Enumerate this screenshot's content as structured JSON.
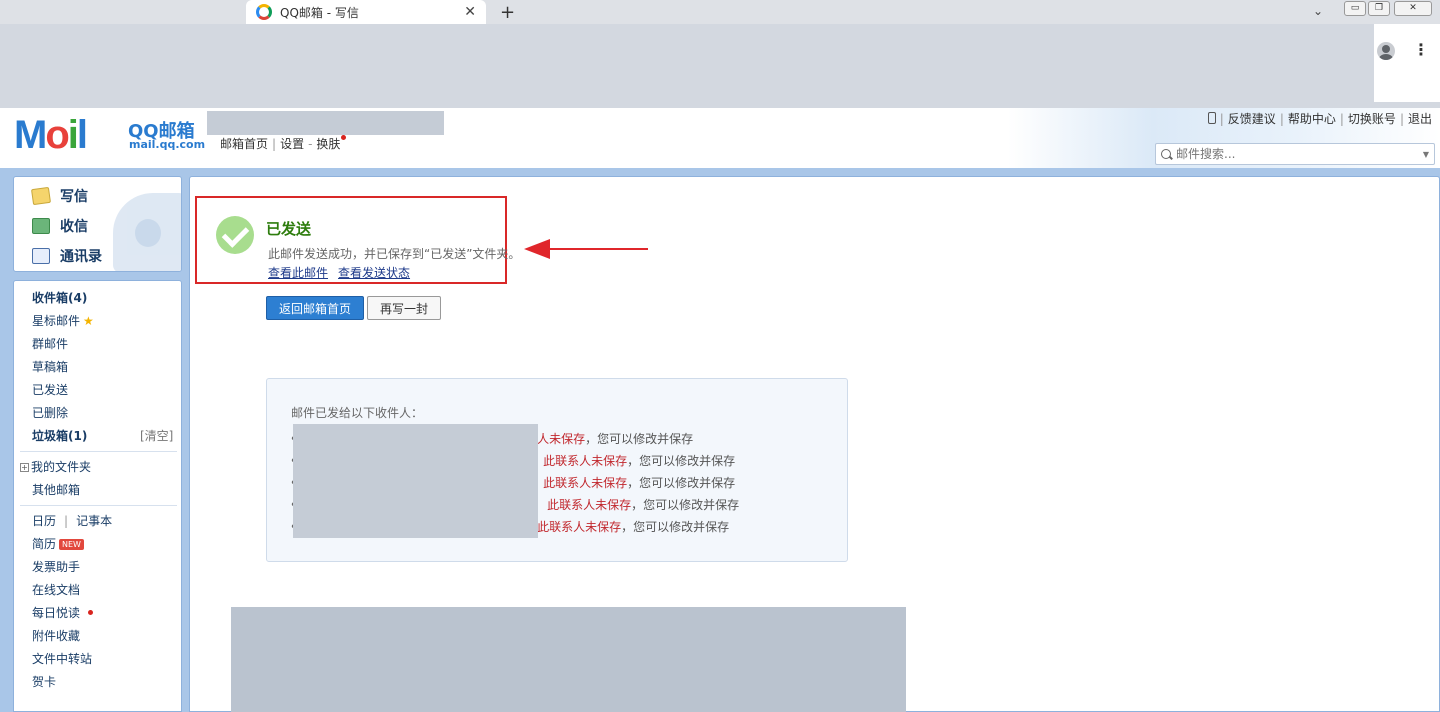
{
  "browser": {
    "tab_title": "QQ邮箱 - 写信",
    "tab_close": "✕",
    "new_tab": "+",
    "tab_dropdown": "⌄",
    "window_controls": [
      "▭",
      "❐",
      "✕"
    ],
    "menu": "⋮"
  },
  "header": {
    "logo_m": "M",
    "logo_o": "o",
    "logo_i": "i",
    "logo_l": "l",
    "logo_name": "QQ邮箱",
    "logo_domain": "mail.qq.com",
    "links": {
      "home": "邮箱首页",
      "settings": "设置",
      "dash": "-",
      "skin": "换肤",
      "sep": "|"
    },
    "top_right": {
      "feedback": "反馈建议",
      "help": "帮助中心",
      "switch": "切换账号",
      "logout": "退出"
    },
    "search_placeholder": "邮件搜索...",
    "search_caret": "▼"
  },
  "sidebar": {
    "quick": {
      "write": "写信",
      "inbox": "收信",
      "contacts": "通讯录"
    },
    "folders": {
      "inbox": "收件箱(4)",
      "starred": "星标邮件",
      "star_glyph": "★",
      "group": "群邮件",
      "drafts": "草稿箱",
      "sent": "已发送",
      "deleted": "已删除",
      "spam": "垃圾箱(1)",
      "clear": "[清空]",
      "my_folders": "我的文件夹",
      "expand_glyph": "+",
      "other": "其他邮箱"
    },
    "apps": {
      "calendar": "日历",
      "sep": "|",
      "notes": "记事本",
      "resume": "简历",
      "new_badge": "NEW",
      "invoice": "发票助手",
      "docs": "在线文档",
      "daily": "每日悦读",
      "attachments": "附件收藏",
      "transfer": "文件中转站",
      "cards": "贺卡"
    }
  },
  "main": {
    "status_title": "已发送",
    "status_desc": "此邮件发送成功，并已保存到“已发送”文件夹。",
    "link_view": "查看此邮件",
    "link_status": "查看发送状态",
    "btn_back": "返回邮箱首页",
    "btn_rewrite": "再写一封",
    "recipients_heading": "邮件已发给以下收件人：",
    "bullet": "•",
    "recipients": [
      {
        "warn": "人未保存",
        "tail": "，您可以修改并保存"
      },
      {
        "warn": "此联系人未保存",
        "tail": "，您可以修改并保存"
      },
      {
        "warn": "此联系人未保存",
        "tail": "，您可以修改并保存"
      },
      {
        "warn": "此联系人未保存",
        "tail": "，您可以修改并保存"
      },
      {
        "warn": "此联系人未保存",
        "tail": "，您可以修改并保存"
      }
    ]
  },
  "colors": {
    "accent": "#2d7fd2",
    "success": "#2e7d0e",
    "warning": "#c1272d",
    "annotation": "#d92828"
  }
}
